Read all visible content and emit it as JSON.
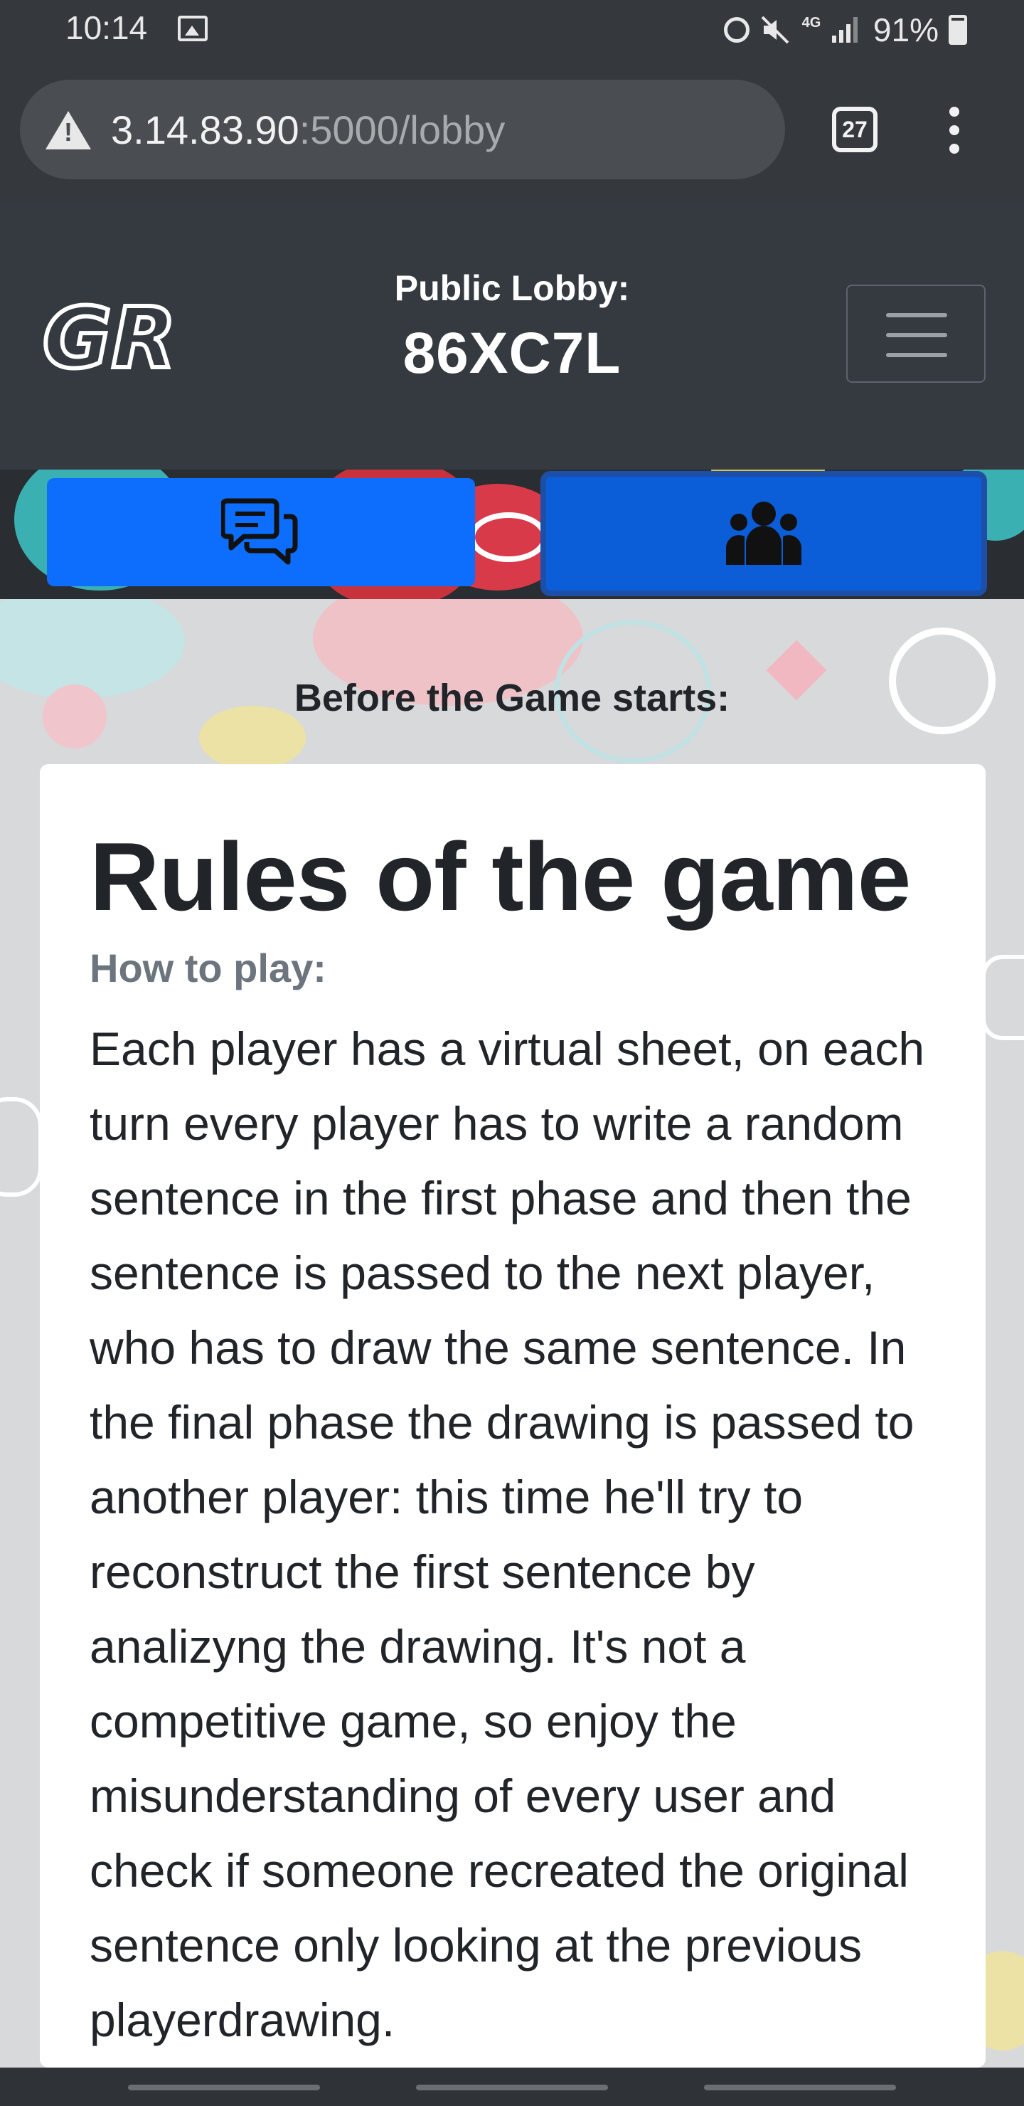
{
  "status_bar": {
    "time": "10:14",
    "network": "4G",
    "battery": "91%",
    "icons": [
      "image-icon",
      "alarm-icon",
      "mute-icon",
      "4g-icon",
      "signal-icon",
      "battery-charging-icon"
    ]
  },
  "browser": {
    "url_host": "3.14.83.90",
    "url_path": ":5000/lobby",
    "tab_count": "27",
    "security_icon": "warning-icon",
    "menu_icon": "more-vert-icon"
  },
  "navbar": {
    "logo_text": "GR",
    "lobby_label": "Public Lobby:",
    "lobby_code": "86XC7L",
    "menu_icon": "hamburger-icon"
  },
  "actions": {
    "chat_icon": "chat-bubbles-icon",
    "users_icon": "users-group-icon"
  },
  "main": {
    "section_heading": "Before the Game starts:"
  },
  "card": {
    "title": "Rules of the game",
    "subtitle": "How to play:",
    "text": "Each player has a virtual sheet, on each turn every player has to write a random sentence in the first phase and then the sentence is passed to the next player, who has to draw the same sentence. In the final phase the drawing is passed to another player: this time he'll try to reconstruct the first sentence by analizyng the drawing. It's not a competitive game, so enjoy the misunderstanding of every user and check if someone recreated the original sentence only looking at the previous playerdrawing."
  },
  "colors": {
    "navbar": "#343a40",
    "primary_button": "#0d6efd",
    "active_button": "#0b5ed7",
    "content_background": "#d7d9db",
    "card": "#ffffff"
  }
}
